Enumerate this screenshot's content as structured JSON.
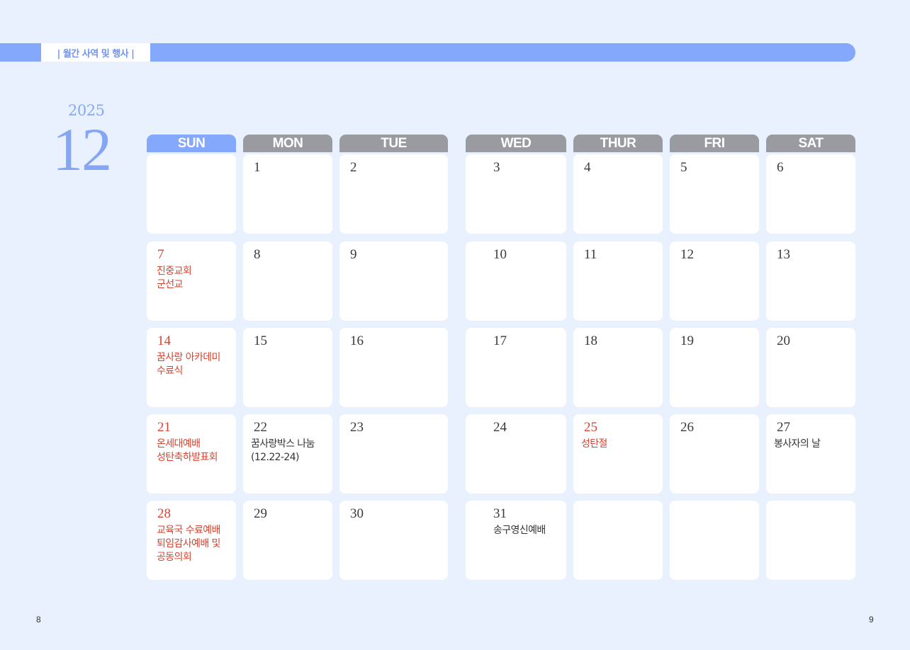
{
  "header": {
    "section_label": "| 월간 사역 및 행사 |"
  },
  "calendar": {
    "year": "2025",
    "month": "12",
    "weekdays": [
      "SUN",
      "MON",
      "TUE",
      "WED",
      "THUR",
      "FRI",
      "SAT"
    ],
    "weeks": [
      [
        {
          "day": "",
          "events": []
        },
        {
          "day": "1",
          "events": []
        },
        {
          "day": "2",
          "events": []
        },
        {
          "day": "3",
          "events": []
        },
        {
          "day": "4",
          "events": []
        },
        {
          "day": "5",
          "events": []
        },
        {
          "day": "6",
          "events": []
        }
      ],
      [
        {
          "day": "7",
          "events": [
            "진중교회",
            "군선교"
          ],
          "holiday": true
        },
        {
          "day": "8",
          "events": []
        },
        {
          "day": "9",
          "events": []
        },
        {
          "day": "10",
          "events": []
        },
        {
          "day": "11",
          "events": []
        },
        {
          "day": "12",
          "events": []
        },
        {
          "day": "13",
          "events": []
        }
      ],
      [
        {
          "day": "14",
          "events": [
            "꿈사랑 아카데미",
            "수료식"
          ],
          "holiday": true
        },
        {
          "day": "15",
          "events": []
        },
        {
          "day": "16",
          "events": []
        },
        {
          "day": "17",
          "events": []
        },
        {
          "day": "18",
          "events": []
        },
        {
          "day": "19",
          "events": []
        },
        {
          "day": "20",
          "events": []
        }
      ],
      [
        {
          "day": "21",
          "events": [
            "온세대예배",
            "성탄축하발표회"
          ],
          "holiday": true
        },
        {
          "day": "22",
          "events": [
            "꿈사랑박스 나눔",
            "(12.22-24)"
          ]
        },
        {
          "day": "23",
          "events": []
        },
        {
          "day": "24",
          "events": []
        },
        {
          "day": "25",
          "events": [
            "성탄절"
          ],
          "holiday": true
        },
        {
          "day": "26",
          "events": []
        },
        {
          "day": "27",
          "events": [
            "봉사자의 날"
          ]
        }
      ],
      [
        {
          "day": "28",
          "events": [
            "교육국 수료예배",
            "퇴임감사예배 및",
            "공동의회"
          ],
          "holiday": true
        },
        {
          "day": "29",
          "events": []
        },
        {
          "day": "30",
          "events": []
        },
        {
          "day": "31",
          "events": [
            "송구영신예배"
          ]
        },
        {
          "day": "",
          "events": []
        },
        {
          "day": "",
          "events": []
        },
        {
          "day": "",
          "events": []
        }
      ]
    ]
  },
  "footer": {
    "page_left": "8",
    "page_right": "9"
  },
  "colors": {
    "accent": "#84a8fc",
    "weekday_gray": "#9a9ba1",
    "holiday_red": "#d9432f",
    "background": "#eaf1fe"
  }
}
